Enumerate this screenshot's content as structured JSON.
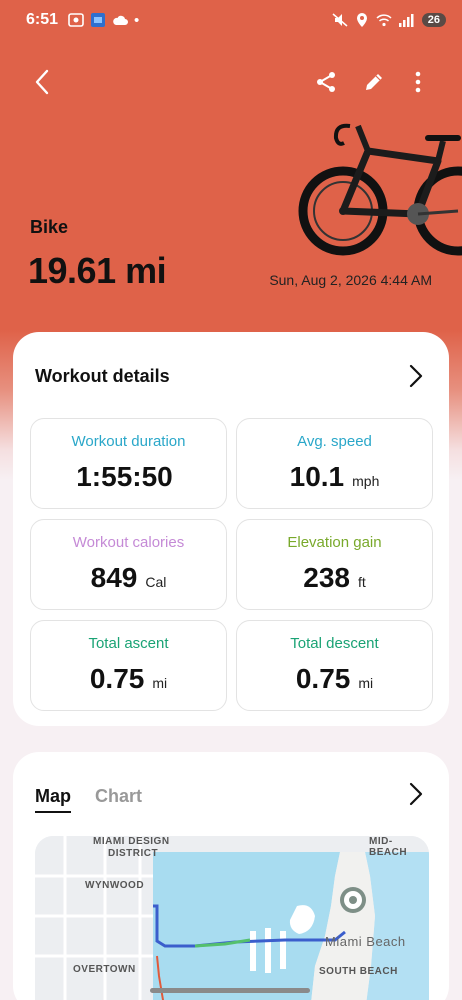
{
  "status_bar": {
    "time": "6:51",
    "battery": "26",
    "dot": "•"
  },
  "header": {
    "activity": "Bike",
    "distance": "19.61 mi",
    "datetime": "Sun, Aug 2, 2026 4:44 AM",
    "background_color": "#df6249"
  },
  "details": {
    "title": "Workout details",
    "stats": [
      {
        "label": "Workout duration",
        "value": "1:55:50",
        "unit": "",
        "color": "#2aa7c9"
      },
      {
        "label": "Avg. speed",
        "value": "10.1",
        "unit": "mph",
        "color": "#2aa7c9"
      },
      {
        "label": "Workout calories",
        "value": "849",
        "unit": "Cal",
        "color": "#c58ad6"
      },
      {
        "label": "Elevation gain",
        "value": "238",
        "unit": "ft",
        "color": "#79a92b"
      },
      {
        "label": "Total ascent",
        "value": "0.75",
        "unit": "mi",
        "color": "#1aa375"
      },
      {
        "label": "Total descent",
        "value": "0.75",
        "unit": "mi",
        "color": "#1aa375"
      }
    ]
  },
  "map_card": {
    "tabs": [
      "Map",
      "Chart"
    ],
    "active_tab": "Map",
    "map_labels": [
      "MIAMI DESIGN",
      "DISTRICT",
      "WYNWOOD",
      "MID-BEACH",
      "Miami Beach",
      "OVERTOWN",
      "SOUTH BEACH"
    ]
  }
}
